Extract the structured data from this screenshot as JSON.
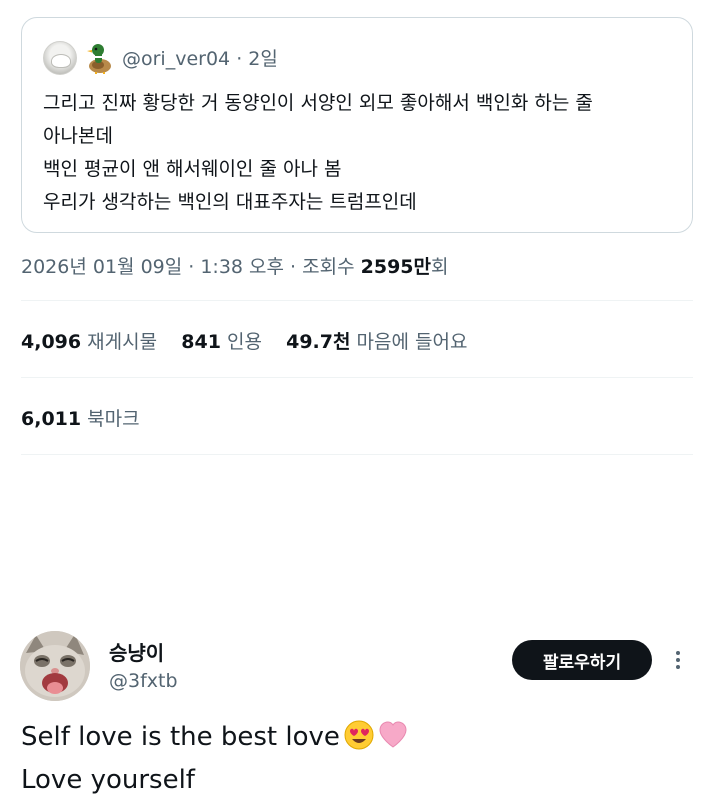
{
  "quoted_tweet": {
    "handle": "@ori_ver04",
    "separator": "·",
    "time": "2일",
    "lines": [
      "그리고 진짜 황당한 거 동양인이 서양인 외모 좋아해서 백인화 하는 줄",
      "아나본데",
      "백인 평균이 앤 해서웨이인 줄 아나 봄",
      "우리가 생각하는 백인의 대표주자는 트럼프인데"
    ]
  },
  "meta": {
    "date": "2026년 01월 09일 · 1:38 오후 · 조회수 ",
    "views_number": "2595만",
    "views_suffix": "회"
  },
  "stats": {
    "reposts_count": "4,096",
    "reposts_label": "재게시물",
    "quotes_count": "841",
    "quotes_label": "인용",
    "likes_count": "49.7천",
    "likes_label": "마음에 들어요",
    "bookmarks_count": "6,011",
    "bookmarks_label": "북마크"
  },
  "reply": {
    "name": "승냥이",
    "handle": "@3fxtb",
    "follow_label": "팔로우하기",
    "line1": "Self love is the best love",
    "line2": "Love yourself",
    "emojis": [
      "heart-eyes-emoji",
      "pink-heart-emoji"
    ]
  },
  "colors": {
    "text": "#0f1419",
    "secondary": "#536471",
    "border": "#cfd9de",
    "divider": "#eff3f4",
    "button_bg": "#0f1419"
  }
}
